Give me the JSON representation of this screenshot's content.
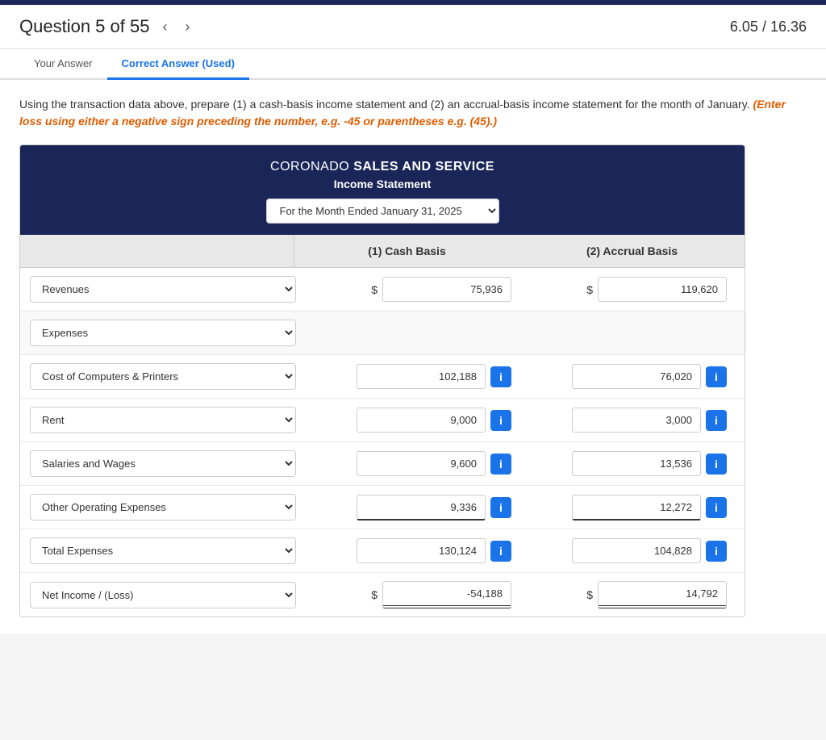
{
  "topbar": {
    "color": "#1a2657"
  },
  "header": {
    "question_label": "Question 5 of 55",
    "nav_prev": "‹",
    "nav_next": "›",
    "score": "6.05 / 16.36"
  },
  "tabs": [
    {
      "label": "Your Answer",
      "active": false
    },
    {
      "label": "Correct Answer (Used)",
      "active": true
    }
  ],
  "instruction": {
    "main": "Using the transaction data above, prepare (1) a cash-basis income statement and (2) an accrual-basis income statement for the month of January.",
    "italic": "(Enter loss using either a negative sign preceding the number, e.g. -45 or parentheses e.g. (45).)"
  },
  "table": {
    "company": "CORONADO",
    "company_bold": "SALES AND SERVICE",
    "subtitle": "Income Statement",
    "date_label": "For the Month Ended January 31, 2025",
    "col1_header": "(1) Cash Basis",
    "col2_header": "(2) Accrual Basis",
    "rows": [
      {
        "label": "Revenues",
        "has_dollar": true,
        "cash_value": "75,936",
        "accrual_value": "119,620",
        "show_info": false,
        "type": "revenues"
      },
      {
        "label": "Expenses",
        "has_dollar": false,
        "cash_value": "",
        "accrual_value": "",
        "show_info": false,
        "type": "section"
      },
      {
        "label": "Cost of Computers & Printers",
        "has_dollar": false,
        "cash_value": "102,188",
        "accrual_value": "76,020",
        "show_info": true,
        "type": "expense"
      },
      {
        "label": "Rent",
        "has_dollar": false,
        "cash_value": "9,000",
        "accrual_value": "3,000",
        "show_info": true,
        "type": "expense"
      },
      {
        "label": "Salaries and Wages",
        "has_dollar": false,
        "cash_value": "9,600",
        "accrual_value": "13,536",
        "show_info": true,
        "type": "expense"
      },
      {
        "label": "Other Operating Expenses",
        "has_dollar": false,
        "cash_value": "9,336",
        "accrual_value": "12,272",
        "show_info": true,
        "type": "expense underline"
      },
      {
        "label": "Total Expenses",
        "has_dollar": false,
        "cash_value": "130,124",
        "accrual_value": "104,828",
        "show_info": true,
        "type": "total"
      },
      {
        "label": "Net Income / (Loss)",
        "has_dollar": true,
        "cash_value": "-54,188",
        "accrual_value": "14,792",
        "show_info": false,
        "type": "net double-underline"
      }
    ],
    "info_btn_label": "i",
    "date_options": [
      "For the Month Ended January 31, 2025"
    ]
  }
}
